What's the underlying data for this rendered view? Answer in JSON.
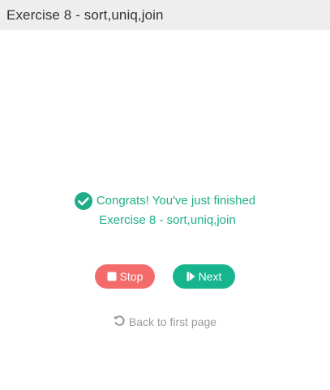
{
  "header": {
    "title": "Exercise 8 - sort,uniq,join"
  },
  "result": {
    "congrats_text": "Congrats! You've just finished",
    "exercise_name": "Exercise 8 - sort,uniq,join",
    "icon": "check-circle-icon"
  },
  "actions": {
    "stop_label": "Stop",
    "stop_icon": "stop-icon",
    "next_label": "Next",
    "next_icon": "step-forward-icon"
  },
  "footer": {
    "back_label": "Back to first page",
    "back_icon": "undo-icon"
  },
  "colors": {
    "success": "#1fae87",
    "stop": "#f46b6b",
    "next": "#17b58e",
    "muted": "#9a9a9a",
    "header_bg": "#eeeeee"
  }
}
